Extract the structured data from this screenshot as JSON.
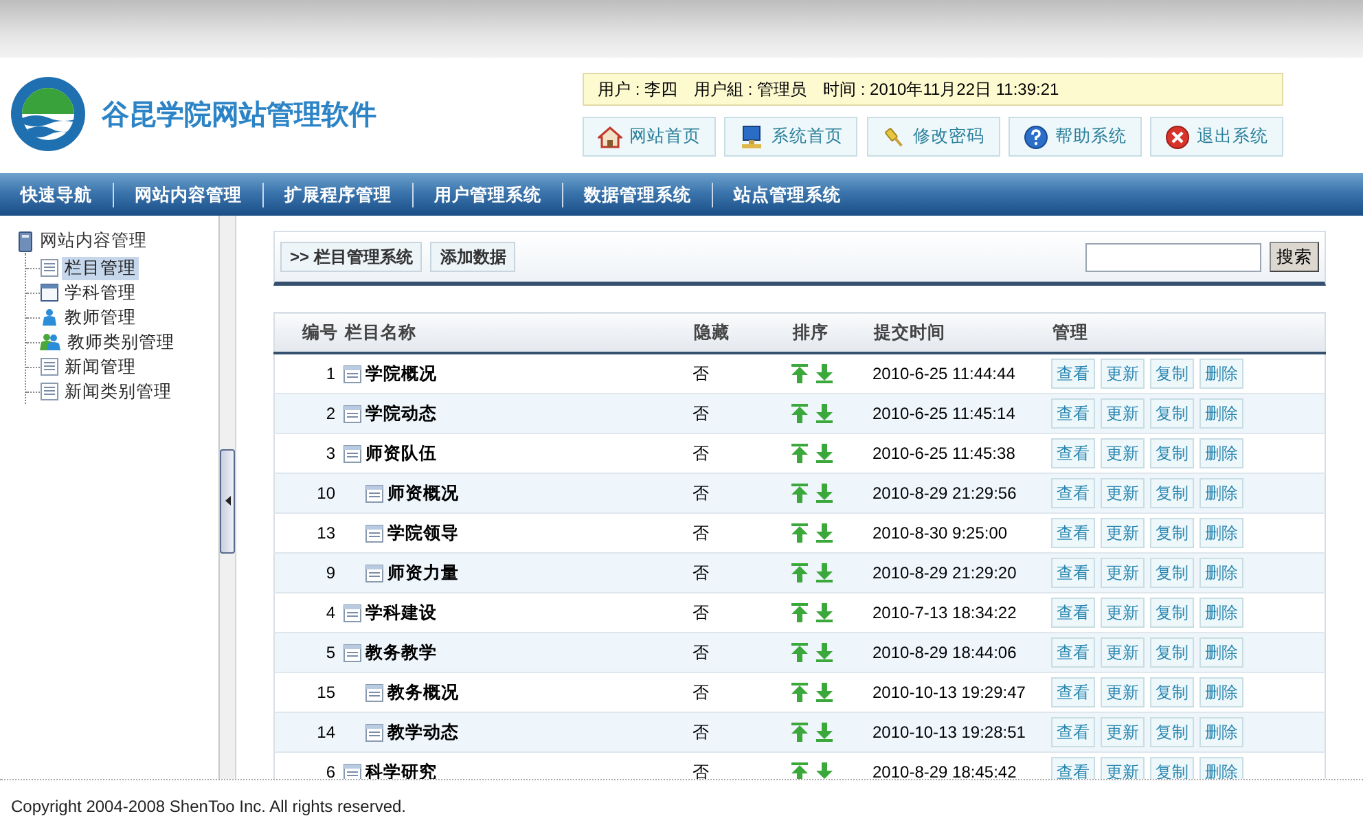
{
  "header": {
    "title": "谷昆学院网站管理软件",
    "user_info": {
      "user_label": "用户 : 李四",
      "group_label": "用户組 : 管理员",
      "time_label": "时间 : 2010年11月22日  11:39:21"
    },
    "buttons": [
      {
        "label": "网站首页",
        "kind": "home"
      },
      {
        "label": "系统首页",
        "kind": "computer"
      },
      {
        "label": "修改密码",
        "kind": "key"
      },
      {
        "label": "帮助系统",
        "kind": "help"
      },
      {
        "label": "退出系统",
        "kind": "exit"
      }
    ]
  },
  "nav": [
    "快速导航",
    "网站内容管理",
    "扩展程序管理",
    "用户管理系统",
    "数据管理系统",
    "站点管理系统"
  ],
  "sidebar": {
    "root": "网站内容管理",
    "items": [
      {
        "label": "栏目管理",
        "kind": "document",
        "selected": true
      },
      {
        "label": "学科管理",
        "kind": "window",
        "selected": false
      },
      {
        "label": "教师管理",
        "kind": "person",
        "selected": false
      },
      {
        "label": "教师类别管理",
        "kind": "group",
        "selected": false
      },
      {
        "label": "新闻管理",
        "kind": "document",
        "selected": false
      },
      {
        "label": "新闻类别管理",
        "kind": "document",
        "selected": false
      }
    ]
  },
  "toolbar": {
    "breadcrumb": ">> 栏目管理系统",
    "add_button": "添加数据",
    "search_button": "搜索"
  },
  "table": {
    "columns": [
      "编号",
      "栏目名称",
      "隐藏",
      "排序",
      "提交时间",
      "管理"
    ],
    "rows": [
      {
        "id": "1",
        "name": "学院概况",
        "hidden": "否",
        "time": "2010-6-25 11:44:44",
        "actions": [
          "查看",
          "更新",
          "复制",
          "删除"
        ]
      },
      {
        "id": "2",
        "name": "学院动态",
        "hidden": "否",
        "time": "2010-6-25 11:45:14",
        "actions": [
          "查看",
          "更新",
          "复制",
          "删除"
        ]
      },
      {
        "id": "3",
        "name": "师资队伍",
        "hidden": "否",
        "time": "2010-6-25 11:45:38",
        "actions": [
          "查看",
          "更新",
          "复制",
          "删除"
        ],
        "children": [
          {
            "id": "10",
            "name": "师资概况",
            "hidden": "否",
            "time": "2010-8-29 21:29:56",
            "actions": [
              "查看",
              "更新",
              "复制",
              "删除"
            ]
          },
          {
            "id": "13",
            "name": "学院领导",
            "hidden": "否",
            "time": "2010-8-30 9:25:00",
            "actions": [
              "查看",
              "更新",
              "复制",
              "删除"
            ]
          },
          {
            "id": "9",
            "name": "师资力量",
            "hidden": "否",
            "time": "2010-8-29 21:29:20",
            "actions": [
              "查看",
              "更新",
              "复制",
              "删除"
            ]
          }
        ]
      },
      {
        "id": "4",
        "name": "学科建设",
        "hidden": "否",
        "time": "2010-7-13 18:34:22",
        "actions": [
          "查看",
          "更新",
          "复制",
          "删除"
        ]
      },
      {
        "id": "5",
        "name": "教务教学",
        "hidden": "否",
        "time": "2010-8-29 18:44:06",
        "actions": [
          "查看",
          "更新",
          "复制",
          "删除"
        ],
        "children": [
          {
            "id": "15",
            "name": "教务概况",
            "hidden": "否",
            "time": "2010-10-13 19:29:47",
            "actions": [
              "查看",
              "更新",
              "复制",
              "删除"
            ]
          },
          {
            "id": "14",
            "name": "教学动态",
            "hidden": "否",
            "time": "2010-10-13 19:28:51",
            "actions": [
              "查看",
              "更新",
              "复制",
              "删除"
            ]
          }
        ]
      },
      {
        "id": "6",
        "name": "科学研究",
        "hidden": "否",
        "time": "2010-8-29 18:45:42",
        "actions": [
          "查看",
          "更新",
          "复制",
          "删除"
        ]
      }
    ]
  },
  "footer": "Copyright 2004-2008 ShenToo Inc. All rights reserved."
}
